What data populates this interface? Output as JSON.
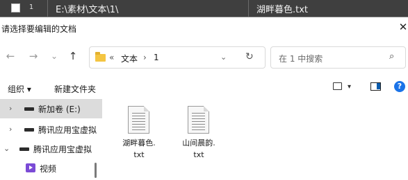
{
  "background_row": {
    "index": "1",
    "path": "E:\\素材\\文本\\1\\",
    "filename": "湖畔暮色.txt"
  },
  "dialog": {
    "title": "请选择要编辑的文档",
    "close_label": "✕"
  },
  "nav": {
    "back": "←",
    "forward": "→",
    "recent": "⌄",
    "up": "↑",
    "address": {
      "prefix": "«",
      "crumbs": [
        "文本",
        "1"
      ],
      "separator": "›",
      "dropdown": "⌄",
      "refresh": "↻"
    },
    "search": {
      "placeholder": "在 1 中搜索",
      "icon": "⌕"
    }
  },
  "toolbar": {
    "organize": "组织 ▾",
    "new_folder": "新建文件夹",
    "view_dropdown": "▾",
    "help": "?"
  },
  "nav_pane": {
    "items": [
      {
        "label": "新加卷 (E:)",
        "caret": "›"
      },
      {
        "label": "腾讯应用宝虚拟",
        "caret": "›"
      },
      {
        "label": "腾讯应用宝虚拟",
        "caret": "⌄"
      },
      {
        "label": "视频",
        "caret": ""
      }
    ]
  },
  "files": [
    {
      "name_line1": "湖畔暮色.",
      "name_line2": "txt"
    },
    {
      "name_line1": "山间晨韵.",
      "name_line2": "txt"
    }
  ],
  "colors": {
    "background_row": "#3f3f3f",
    "folder": "#f4c542",
    "selected_nav": "#dcdcdc",
    "accent": "#1a73e8"
  }
}
